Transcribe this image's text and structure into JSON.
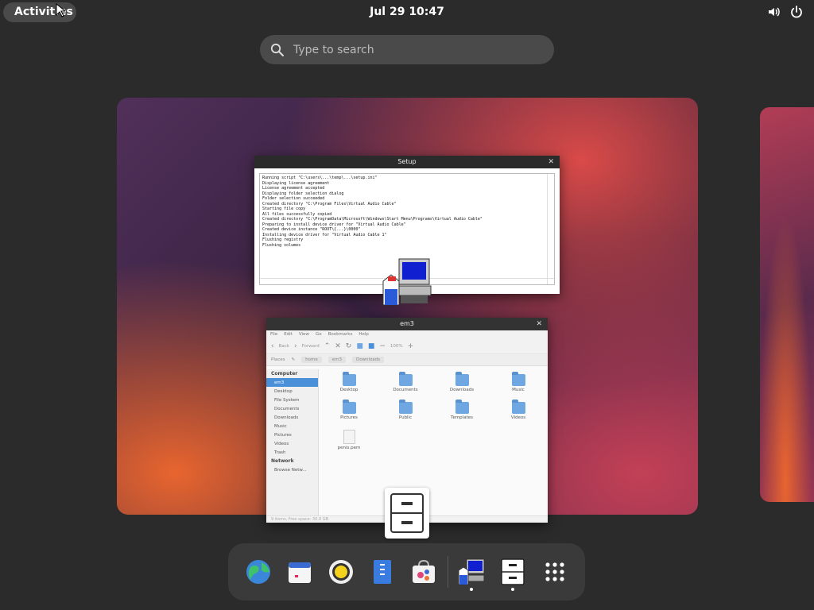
{
  "topbar": {
    "activities_label": "Activities",
    "clock": "Jul 29  10:47",
    "icons": [
      "volume-icon",
      "power-icon"
    ]
  },
  "search": {
    "placeholder": "Type to search"
  },
  "windows": {
    "setup": {
      "title": "Setup",
      "log_lines": [
        "Running script \"C:\\users\\...\\temp\\...\\setup.ini\"",
        "Displaying license agreement",
        "License agreement accepted",
        "Displaying folder selection dialog",
        "Folder selection succeeded",
        "Created directory \"C:\\Program Files\\Virtual Audio Cable\"",
        "Starting file copy",
        "All files successfully copied",
        "Created directory \"C:\\ProgramData\\Microsoft\\Windows\\Start Menu\\Programs\\Virtual Audio Cable\"",
        "Preparing to install device driver for \"Virtual Audio Cable\"",
        "Created device instance \"ROOT\\{...}\\0000\"",
        "Installing device driver for \"Virtual Audio Cable 1\"",
        "Flushing registry",
        "Flushing volumes"
      ]
    },
    "file_manager": {
      "title": "em3",
      "menu": [
        "File",
        "Edit",
        "View",
        "Go",
        "Bookmarks",
        "Help"
      ],
      "toolbar": {
        "back_label": "Back",
        "forward_label": "Forward",
        "zoom": "100%"
      },
      "location": {
        "places_label": "Places",
        "crumbs": [
          "home",
          "em3",
          "Downloads"
        ]
      },
      "sidebar": {
        "computer_header": "Computer",
        "computer_items": [
          "em3",
          "Desktop",
          "File System",
          "Documents",
          "Downloads",
          "Music",
          "Pictures",
          "Videos",
          "Trash"
        ],
        "network_header": "Network",
        "network_items": [
          "Browse Netw..."
        ]
      },
      "files": [
        {
          "name": "Desktop",
          "kind": "folder"
        },
        {
          "name": "Documents",
          "kind": "folder"
        },
        {
          "name": "Downloads",
          "kind": "folder"
        },
        {
          "name": "Music",
          "kind": "folder"
        },
        {
          "name": "Pictures",
          "kind": "folder"
        },
        {
          "name": "Public",
          "kind": "folder"
        },
        {
          "name": "Templates",
          "kind": "folder"
        },
        {
          "name": "Videos",
          "kind": "folder"
        },
        {
          "name": "penis.pem",
          "kind": "file"
        }
      ],
      "status": "9 items, Free space: 30.0 GB"
    }
  },
  "dock": {
    "apps": [
      {
        "name": "web-browser-icon"
      },
      {
        "name": "calendar-icon"
      },
      {
        "name": "rhythmbox-icon"
      },
      {
        "name": "text-editor-icon"
      },
      {
        "name": "software-center-icon"
      },
      {
        "name": "setup-installer-icon",
        "running": true
      },
      {
        "name": "file-manager-icon",
        "running": true
      },
      {
        "name": "app-grid-icon"
      }
    ]
  },
  "colors": {
    "accent": "#4a90d9",
    "panel_bg": "#2b2b2b",
    "dock_bg": "#3a3a3a"
  }
}
